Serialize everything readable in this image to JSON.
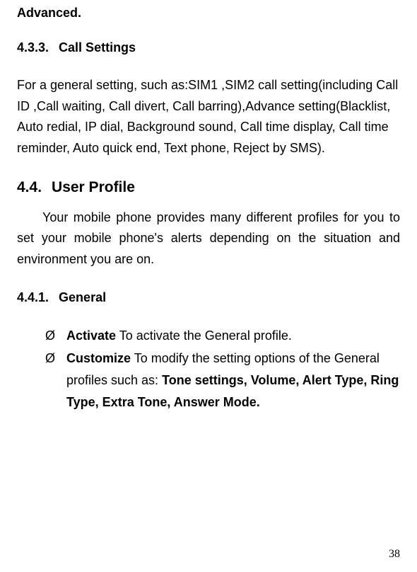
{
  "topHeading": "Advanced.",
  "section_4_3_3": {
    "number": "4.3.3.",
    "title": "Call Settings",
    "paragraph": "For a general setting, such as:SIM1 ,SIM2 call setting(including Call ID ,Call waiting, Call divert, Call barring),Advance setting(Blacklist, Auto redial, IP dial, Background sound, Call time display, Call time reminder, Auto quick end, Text phone, Reject by SMS)."
  },
  "section_4_4": {
    "number": "4.4.",
    "title": "User Profile",
    "paragraph": "Your mobile phone provides many different profiles for you to set your mobile phone's alerts depending on the situation and environment you are on."
  },
  "section_4_4_1": {
    "number": "4.4.1.",
    "title": "General",
    "items": [
      {
        "bullet": "Ø",
        "bold": "Activate",
        "text": " To activate the General profile."
      },
      {
        "bullet": "Ø",
        "bold": "Customize",
        "text": " To modify the setting options of the General profiles such as: ",
        "bold2": "Tone settings, Volume, Alert Type, Ring Type, Extra Tone, Answer Mode."
      }
    ]
  },
  "pageNumber": "38"
}
